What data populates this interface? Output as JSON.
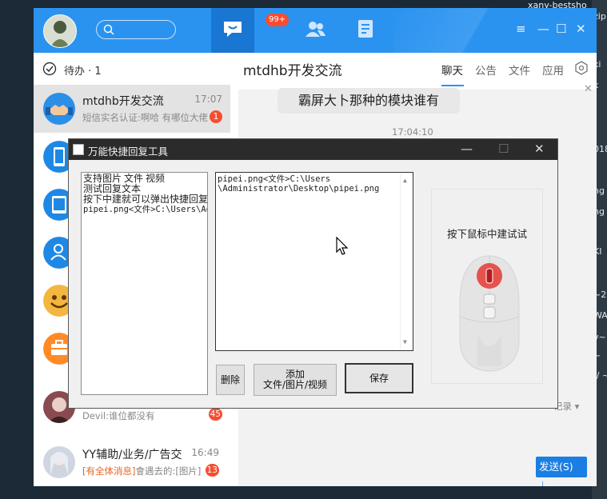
{
  "desktop": {
    "top_text": "xany-bestsho",
    "right_slivers": [
      "zip",
      "ki",
      "k",
      "018",
      "ng",
      "ng",
      "KI",
      "~2",
      "WA",
      "v~",
      "~",
      "\\/ ~"
    ]
  },
  "window": {
    "search_placeholder": "",
    "badge": "99+",
    "controls": {
      "menu": "≡",
      "minimize": "—",
      "maximize": "☐",
      "close": "✕"
    }
  },
  "todo": {
    "label": "待办 · 1"
  },
  "sessions": [
    {
      "name": "mtdhb开发交流",
      "time": "17:07",
      "msg": "短信实名认证:啊哈 有哪位大佬",
      "badge": "1"
    },
    {
      "name": "",
      "time": "",
      "msg": "",
      "badge": ""
    },
    {
      "name": "",
      "time": "",
      "msg": "",
      "badge": ""
    },
    {
      "name": "",
      "time": "",
      "msg": "",
      "badge": ""
    },
    {
      "name": "",
      "time": "",
      "msg": "",
      "badge": ""
    },
    {
      "name": "",
      "time": "",
      "msg": "",
      "badge": ""
    },
    {
      "name": "",
      "time": "",
      "msg": "Devil:谁位都没有",
      "badge": "45"
    },
    {
      "name": "YY辅助/业务/广告交",
      "time": "16:49",
      "msg_highlight": "[有全体消息]",
      "msg": "會遇去的:[图片]",
      "badge": "13"
    }
  ],
  "chat": {
    "title": "mtdhb开发交流",
    "tabs": [
      "聊天",
      "公告",
      "文件",
      "应用"
    ],
    "bubble_text": "霸屏大卜那种的模块谁有",
    "timestamp": "17:04:10",
    "history_label": "记录 ▾",
    "send_label": "发送(S)",
    "send_arrow": "▾"
  },
  "dialog": {
    "title": "万能快捷回复工具",
    "controls": {
      "minimize": "—",
      "maximize": "☐",
      "close": "✕"
    },
    "list_items": [
      "支持图片 文件 视频",
      "测试回复文本",
      "按下中建就可以弹出快捷回复",
      "pipei.png<文件>C:\\Users\\Ad"
    ],
    "edit_text_line1": "pipei.png<文件>C:\\Users",
    "edit_text_line2": "\\Administrator\\Desktop\\pipei.png",
    "delete_label": "删除",
    "add_label_line1": "添加",
    "add_label_line2": "文件/图片/视频",
    "save_label": "保存",
    "mouse_hint": "按下鼠标中建试试"
  },
  "colors": {
    "titlebar_blue": "#2a93f0",
    "badge_red": "#f74c31",
    "send_blue": "#1b7ee3",
    "middle_button_red": "#e53935"
  }
}
